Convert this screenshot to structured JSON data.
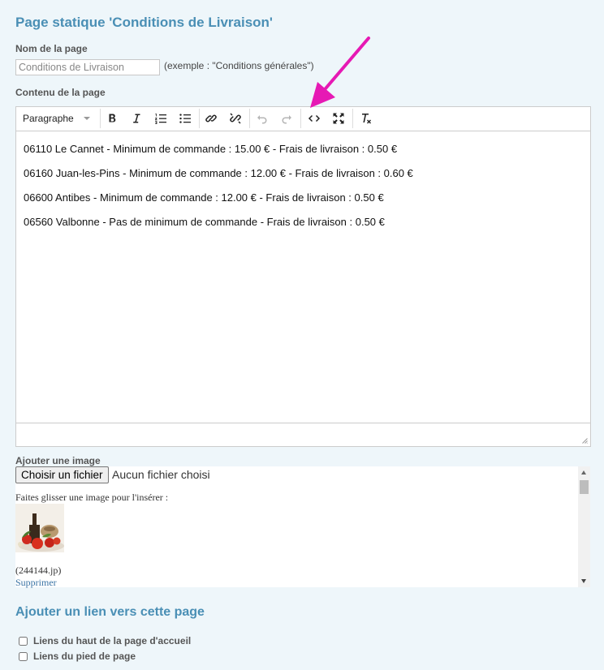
{
  "page": {
    "title": "Page statique 'Conditions de Livraison'"
  },
  "name_field": {
    "label": "Nom de la page",
    "value": "Conditions de Livraison",
    "hint": "(exemple : \"Conditions générales\")"
  },
  "content_field": {
    "label": "Contenu de la page"
  },
  "editor": {
    "toolbar": {
      "block_format": "Paragraphe",
      "buttons": [
        "bold-icon",
        "italic-icon",
        "numbered-list-icon",
        "bullet-list-icon",
        "link-icon",
        "unlink-icon",
        "undo-icon",
        "redo-icon",
        "source-code-icon",
        "fullscreen-icon",
        "clear-formatting-icon"
      ]
    },
    "lines": [
      "06110 Le Cannet - Minimum de commande : 15.00 € - Frais de livraison : 0.50 €",
      "06160 Juan-les-Pins - Minimum de commande : 12.00 € - Frais de livraison : 0.60 €",
      "06600 Antibes - Minimum de commande : 12.00 € - Frais de livraison : 0.50 €",
      "06560 Valbonne - Pas de minimum de commande - Frais de livraison : 0.50 €"
    ]
  },
  "annotation": {
    "arrow_color": "#e619b4"
  },
  "image_section": {
    "label": "Ajouter une image",
    "file_button": "Choisir un fichier",
    "no_file": "Aucun fichier choisi",
    "drag_hint": "Faites glisser une image pour l'insérer :",
    "filename": "(244144.jp)",
    "delete_link": "Supprimer"
  },
  "link_section": {
    "title": "Ajouter un lien vers cette page",
    "options": [
      {
        "label": "Liens du haut de la page d'accueil",
        "checked": false
      },
      {
        "label": "Liens du pied de page",
        "checked": false
      }
    ]
  },
  "colors": {
    "accent": "#4a8fb5",
    "background": "#eef6fa",
    "link": "#3a74a5"
  }
}
